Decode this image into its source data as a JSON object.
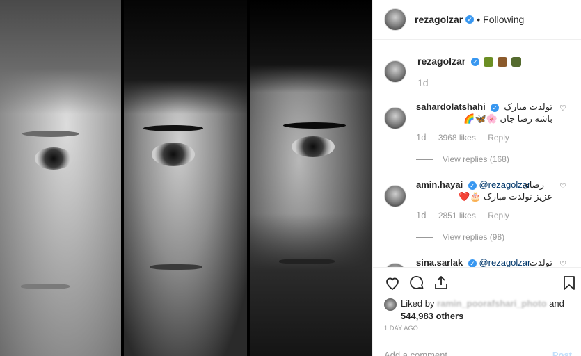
{
  "header": {
    "username": "rezagolzar",
    "separator": "•",
    "follow_status": "Following"
  },
  "caption": {
    "username": "rezagolzar",
    "emojis": [
      "#6b8e23",
      "#8b5a2b",
      "#556b2f"
    ],
    "time": "1d"
  },
  "comments": [
    {
      "username": "sahardolatshahi",
      "line1": "تولدت مبارک",
      "line2": "باشه رضا جان 🌸🦋🌈",
      "time": "1d",
      "likes": "3968 likes",
      "reply": "Reply",
      "view_replies": "View replies (168)"
    },
    {
      "username": "amin.hayai",
      "mention": "@rezagolzar",
      "line1": "رضای",
      "line2": "عزیز تولدت مبارک 🎂❤️",
      "time": "1d",
      "likes": "2851 likes",
      "reply": "Reply",
      "view_replies": "View replies (98)"
    },
    {
      "username": "sina.sarlak",
      "mention": "@rezagolzar",
      "line1": "تولدت"
    }
  ],
  "liked_by": {
    "prefix": "Liked by",
    "name": "ramin_poorafshari_photo",
    "and": "and",
    "others": "544,983 others"
  },
  "time_ago": "1 DAY AGO",
  "add_comment": {
    "placeholder": "Add a comment...",
    "post": "Post"
  },
  "colors": {
    "verified": "#3897f0",
    "mention": "#00376b",
    "muted": "#999999",
    "border": "#efefef"
  }
}
